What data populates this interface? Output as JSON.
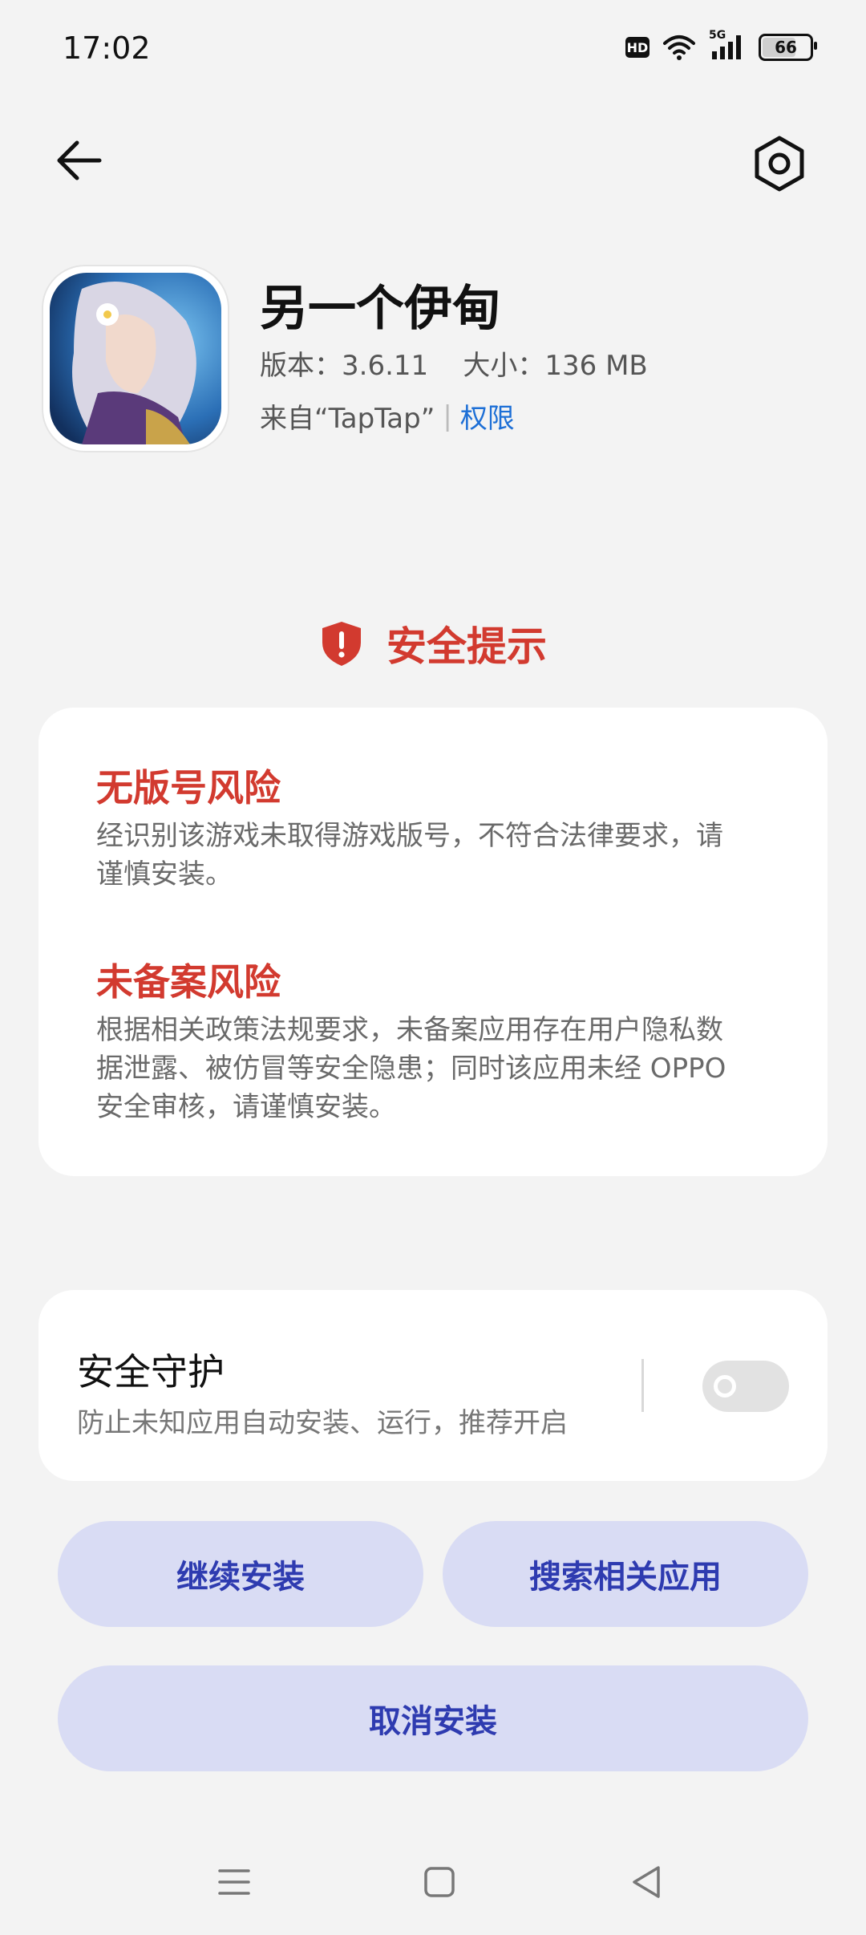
{
  "status_bar": {
    "time": "17:02",
    "hd_label": "HD",
    "network": "5G",
    "battery": "66"
  },
  "icons": {
    "back": "arrow-left-icon",
    "settings": "hexagon-gear-icon",
    "shield": "shield-alert-icon"
  },
  "app": {
    "name": "另一个伊甸",
    "meta": "版本：3.6.11    大小：136 MB",
    "source": "来自“TapTap”",
    "permissions_link": "权限"
  },
  "security": {
    "title": "安全提示",
    "risks": [
      {
        "title": "无版号风险",
        "body_lines": [
          "经识别该游戏未取得游戏版号，不符合法律要求，请",
          "谨慎安装。"
        ]
      },
      {
        "title": "未备案风险",
        "body_lines": [
          "根据相关政策法规要求，未备案应用存在用户隐私数",
          "据泄露、被仿冒等安全隐患；同时该应用未经 OPPO",
          "安全审核，请谨慎安装。"
        ]
      }
    ]
  },
  "protection": {
    "title": "安全守护",
    "description": "防止未知应用自动安装、运行，推荐开启",
    "enabled": false
  },
  "buttons": {
    "continue_install": "继续安装",
    "search_related": "搜索相关应用",
    "cancel_install": "取消安装"
  },
  "colors": {
    "accent": "#2e3bb0",
    "button_bg": "#d9dcf4",
    "danger": "#d23a2f",
    "link": "#1d6fd6",
    "background": "#f3f3f3"
  }
}
